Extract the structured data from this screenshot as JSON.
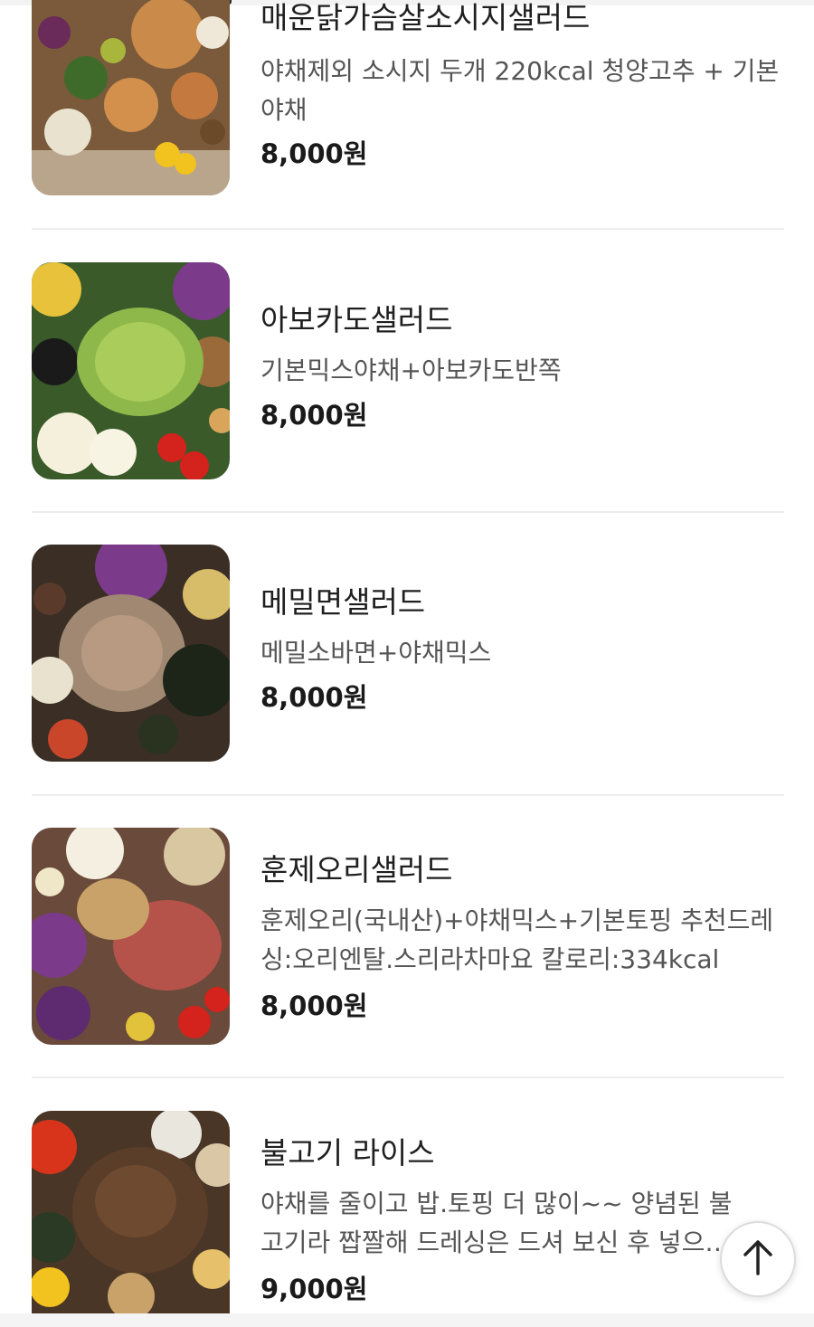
{
  "menu": {
    "items": [
      {
        "name": "매운닭가슴살소시지샐러드",
        "description": "야채제외 소시지 두개 220kcal 청양고추 + 기본야채",
        "price": "8,000원",
        "image_icon": "spicy-chicken-sausage-salad-photo"
      },
      {
        "name": "아보카도샐러드",
        "description": "기본믹스야채+아보카도반쪽",
        "price": "8,000원",
        "image_icon": "avocado-salad-photo"
      },
      {
        "name": "메밀면샐러드",
        "description": "메밀소바면+야채믹스",
        "price": "8,000원",
        "image_icon": "buckwheat-noodle-salad-photo"
      },
      {
        "name": "훈제오리샐러드",
        "description": "훈제오리(국내산)+야채믹스+기본토핑 추천드레싱:오리엔탈.스리라차마요 칼로리:334kcal",
        "price": "8,000원",
        "image_icon": "smoked-duck-salad-photo"
      },
      {
        "name": "불고기 라이스",
        "description": "야채를 줄이고 밥.토핑 더 많이~~ 양념된 불고기라 짭짤해 드레싱은 드셔 보신 후 넣으세요",
        "price": "9,000원",
        "image_icon": "bulgogi-rice-photo"
      }
    ]
  },
  "scroll_top_button": {
    "icon": "arrow-up-icon"
  }
}
